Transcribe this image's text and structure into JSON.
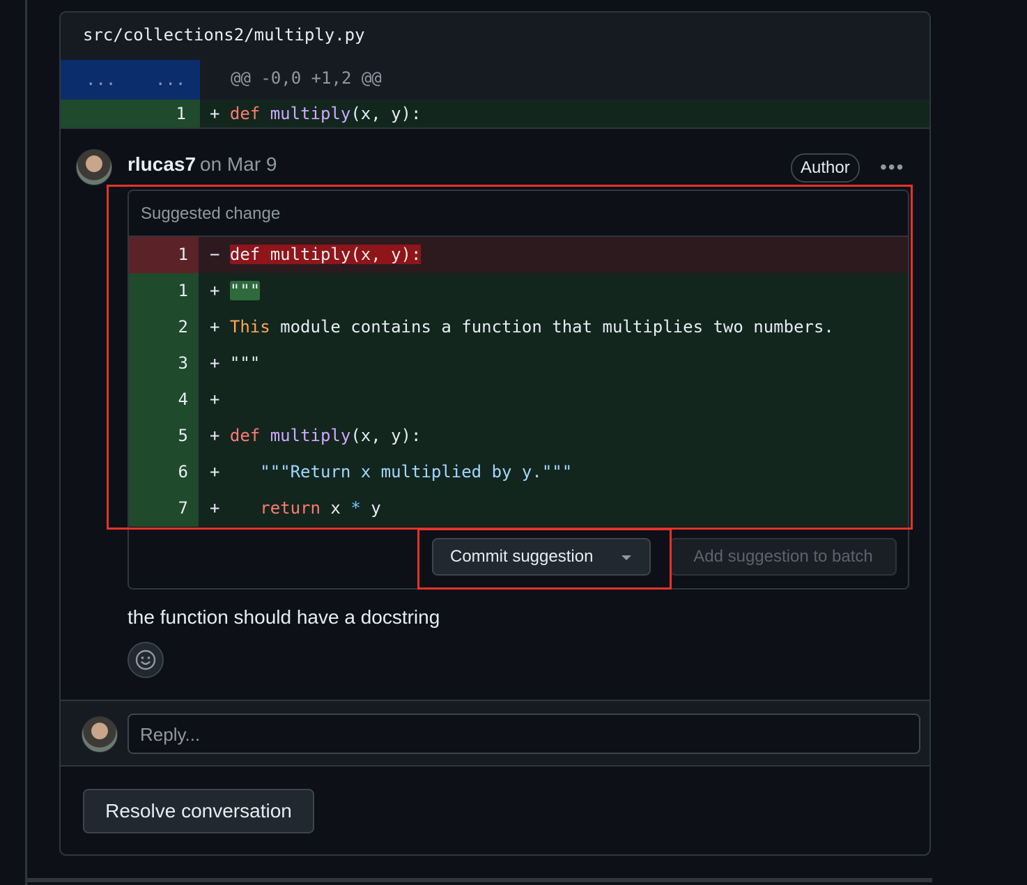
{
  "file": {
    "path": "src/collections2/multiply.py",
    "hunk": {
      "old_marker": "...",
      "new_marker": "...",
      "header": "@@ -0,0 +1,2 @@"
    },
    "diff_line": {
      "number": "1",
      "sign": "+ ",
      "keyword": "def",
      "func": "multiply",
      "rest": "(x, y):"
    }
  },
  "comment": {
    "author": "rlucas7",
    "date": "on Mar 9",
    "badge": "Author",
    "menu_glyph": "•••",
    "body": "the function should have a docstring"
  },
  "suggestion": {
    "header": "Suggested change",
    "removed": {
      "number": "1",
      "sign": "−",
      "text": "def multiply(x, y):"
    },
    "added": [
      {
        "number": "1",
        "sign": "+",
        "text": "\"\"\""
      },
      {
        "number": "2",
        "sign": "+",
        "first_word": "This",
        "text": " module contains a function that multiplies two numbers."
      },
      {
        "number": "3",
        "sign": "+",
        "text": "\"\"\""
      },
      {
        "number": "4",
        "sign": "+",
        "text": ""
      },
      {
        "number": "5",
        "sign": "+",
        "keyword": "def",
        "func": "multiply",
        "text": "(x, y):"
      },
      {
        "number": "6",
        "sign": "+",
        "text": "\"\"\"Return x multiplied by y.\"\"\""
      },
      {
        "number": "7",
        "sign": "+",
        "keyword": "return",
        "left": " x ",
        "op": "*",
        "right": " y"
      }
    ],
    "commit_button": "Commit suggestion",
    "batch_button": "Add suggestion to batch"
  },
  "reply": {
    "placeholder": "Reply..."
  },
  "resolve_button": "Resolve conversation",
  "colors": {
    "background": "#0d1117",
    "highlight_box": "#e5322d",
    "addition_bg": "#12261e",
    "deletion_bg": "#2c1a1f"
  }
}
